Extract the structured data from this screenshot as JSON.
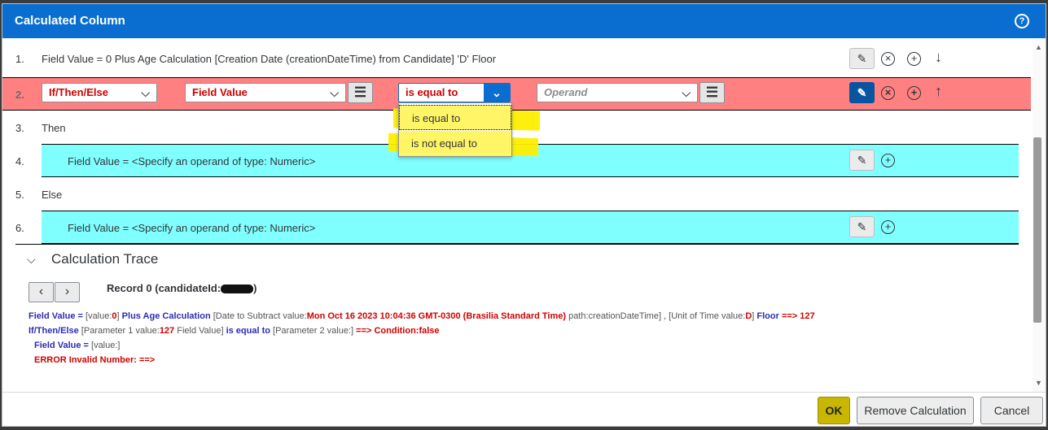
{
  "dialog": {
    "title": "Calculated Column",
    "help_icon": "?"
  },
  "rows": {
    "r1": {
      "num": "1.",
      "text": "Field Value = 0 Plus Age Calculation [Creation Date (creationDateTime) from Candidate] 'D' Floor"
    },
    "r2": {
      "num": "2.",
      "type_select": "If/Then/Else",
      "field_select": "Field Value",
      "operator_select": "is equal to",
      "operand_placeholder": "Operand"
    },
    "r3": {
      "num": "3.",
      "text": "Then"
    },
    "r4": {
      "num": "4.",
      "text": "Field Value = <Specify an operand of type: Numeric>"
    },
    "r5": {
      "num": "5.",
      "text": "Else"
    },
    "r6": {
      "num": "6.",
      "text": "Field Value = <Specify an operand of type: Numeric>"
    }
  },
  "dropdown": {
    "options": [
      "is equal to",
      "is not equal to"
    ],
    "selected_index": 0,
    "highlight_color": "#ffee00"
  },
  "trace": {
    "title": "Calculation Trace",
    "record_label": "Record 0 (candidateId:",
    "record_suffix": ")",
    "line1": {
      "a": "Field Value =",
      "b": " [value:",
      "c": "0",
      "d": "] ",
      "e": "Plus Age Calculation",
      "f": " [Date to Subtract value:",
      "g": "Mon Oct 16 2023 10:04:36 GMT-0300 (Brasilia Standard Time)",
      "h": " path:creationDateTime] , [Unit of Time value:",
      "i": "D",
      "j": "] ",
      "k": "Floor",
      "l": " ==> 127"
    },
    "line2": {
      "a": "If/Then/Else",
      "b": " [Parameter 1 value:",
      "c": "127",
      "d": " Field Value] ",
      "e": "is equal to",
      "f": " [Parameter 2 value:] ",
      "g": "==> Condition:false"
    },
    "line3": {
      "a": "Field Value =",
      "b": " [value:]"
    },
    "line4": {
      "a": "ERROR Invalid Number: ==>"
    }
  },
  "footer": {
    "ok": "OK",
    "remove": "Remove Calculation",
    "cancel": "Cancel"
  },
  "colors": {
    "title_bar": "#0a6ed1",
    "error_row": "#ff8080",
    "branch_row": "#80ffff",
    "ok_button": "#c9b600"
  },
  "icons": [
    "help-icon",
    "pencil-icon",
    "close-circle-icon",
    "plus-circle-icon",
    "arrow-down-icon",
    "arrow-up-icon",
    "hamburger-icon",
    "chevron-down-icon",
    "chevron-left-icon",
    "chevron-right-icon"
  ]
}
